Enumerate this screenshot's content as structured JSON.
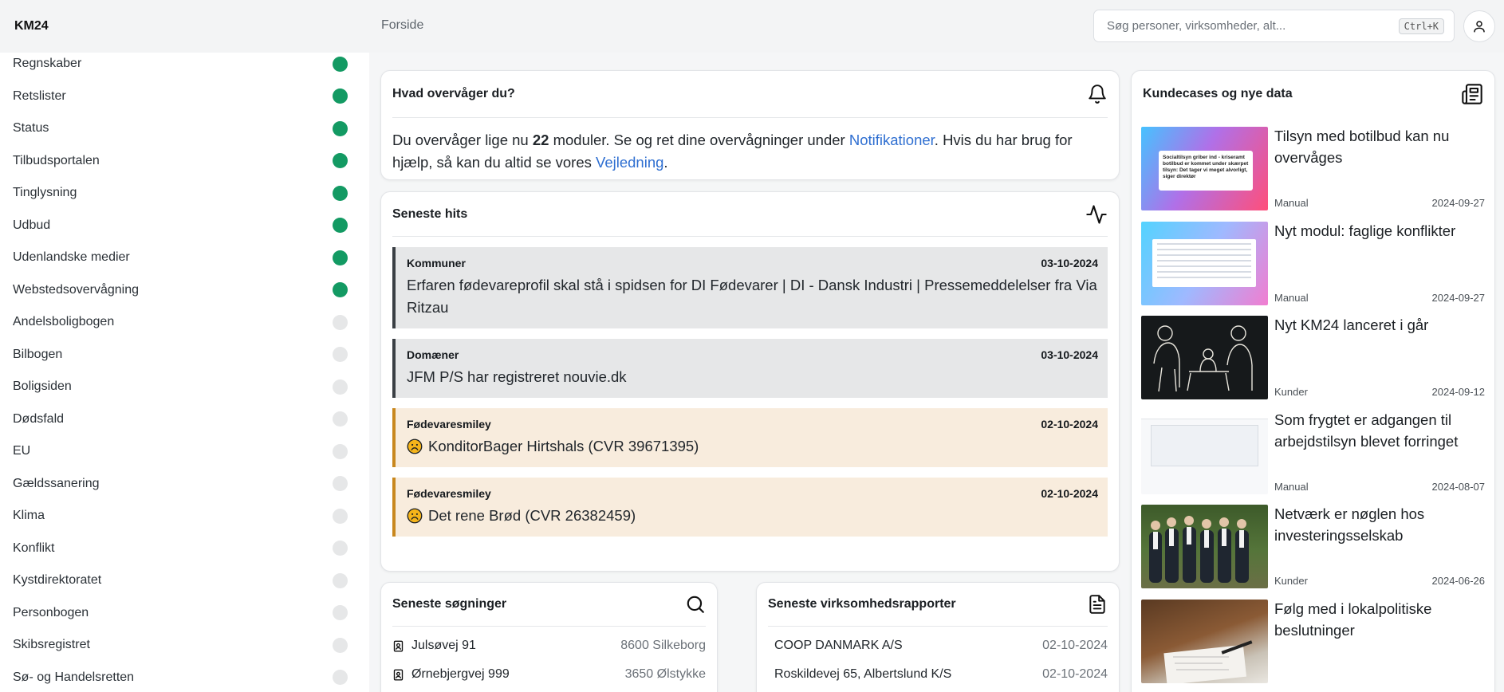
{
  "brand": "KM24",
  "breadcrumb": "Forside",
  "search": {
    "placeholder": "Søg personer, virksomheder, alt...",
    "shortcut": "Ctrl+K"
  },
  "modules": [
    {
      "label": "Regnskaber",
      "active": true
    },
    {
      "label": "Retslister",
      "active": true
    },
    {
      "label": "Status",
      "active": true
    },
    {
      "label": "Tilbudsportalen",
      "active": true
    },
    {
      "label": "Tinglysning",
      "active": true
    },
    {
      "label": "Udbud",
      "active": true
    },
    {
      "label": "Udenlandske medier",
      "active": true
    },
    {
      "label": "Webstedsovervågning",
      "active": true
    },
    {
      "label": "Andelsboligbogen",
      "active": false
    },
    {
      "label": "Bilbogen",
      "active": false
    },
    {
      "label": "Boligsiden",
      "active": false
    },
    {
      "label": "Dødsfald",
      "active": false
    },
    {
      "label": "EU",
      "active": false
    },
    {
      "label": "Gældssanering",
      "active": false
    },
    {
      "label": "Klima",
      "active": false
    },
    {
      "label": "Konflikt",
      "active": false
    },
    {
      "label": "Kystdirektoratet",
      "active": false
    },
    {
      "label": "Personbogen",
      "active": false
    },
    {
      "label": "Skibsregistret",
      "active": false
    },
    {
      "label": "Sø- og Handelsretten",
      "active": false
    }
  ],
  "watch": {
    "title": "Hvad overvåger du?",
    "pre": "Du overvåger lige nu ",
    "count": "22",
    "mid": " moduler. Se og ret dine overvågninger under ",
    "link1": "Notifikationer",
    "mid2": ". Hvis du har brug for hjælp, så kan du altid se vores ",
    "link2": "Vejledning",
    "post": "."
  },
  "hits": {
    "title": "Seneste hits",
    "items": [
      {
        "source": "Kommuner",
        "date": "03-10-2024",
        "text": "Erfaren fødevareprofil skal stå i spidsen for DI Fødevarer | DI - Dansk Industri | Pressemeddelelser fra Via Ritzau",
        "warn": false
      },
      {
        "source": "Domæner",
        "date": "03-10-2024",
        "text": "JFM P/S har registreret nouvie.dk",
        "warn": false
      },
      {
        "source": "Fødevaresmiley",
        "date": "02-10-2024",
        "text": "KonditorBager Hirtshals (CVR 39671395)",
        "warn": true
      },
      {
        "source": "Fødevaresmiley",
        "date": "02-10-2024",
        "text": "Det rene Brød (CVR 26382459)",
        "warn": true
      }
    ]
  },
  "searches": {
    "title": "Seneste søgninger",
    "items": [
      {
        "label": "Julsøvej 91",
        "place": "8600 Silkeborg"
      },
      {
        "label": "Ørnebjergvej 999",
        "place": "3650 Ølstykke"
      }
    ]
  },
  "reports": {
    "title": "Seneste virksomhedsrapporter",
    "items": [
      {
        "label": "COOP DANMARK A/S",
        "date": "02-10-2024"
      },
      {
        "label": "Roskildevej 65, Albertslund K/S",
        "date": "02-10-2024"
      }
    ]
  },
  "news": {
    "title": "Kundecases og nye data",
    "items": [
      {
        "title": "Tilsyn med botilbud kan nu overvåges",
        "tag": "Manual",
        "date": "2024-09-27",
        "thumb_text": "Socialtilsyn griber ind - kriseramt botilbud er kommet under skærpet tilsyn: Det tager vi meget alvorligt, siger direktør"
      },
      {
        "title": "Nyt modul: faglige konflikter",
        "tag": "Manual",
        "date": "2024-09-27"
      },
      {
        "title": "Nyt KM24 lanceret i går",
        "tag": "Kunder",
        "date": "2024-09-12"
      },
      {
        "title": "Som frygtet er adgangen til arbejdstilsyn blevet forringet",
        "tag": "Manual",
        "date": "2024-08-07"
      },
      {
        "title": "Netværk er nøglen hos investeringsselskab",
        "tag": "Kunder",
        "date": "2024-06-26"
      },
      {
        "title": "Følg med i lokalpolitiske beslutninger",
        "tag": "",
        "date": ""
      }
    ]
  },
  "colors": {
    "active": "#139a63",
    "inactive": "#e6e7e8",
    "link": "#2f6fd1",
    "warn": "#c8871d"
  }
}
